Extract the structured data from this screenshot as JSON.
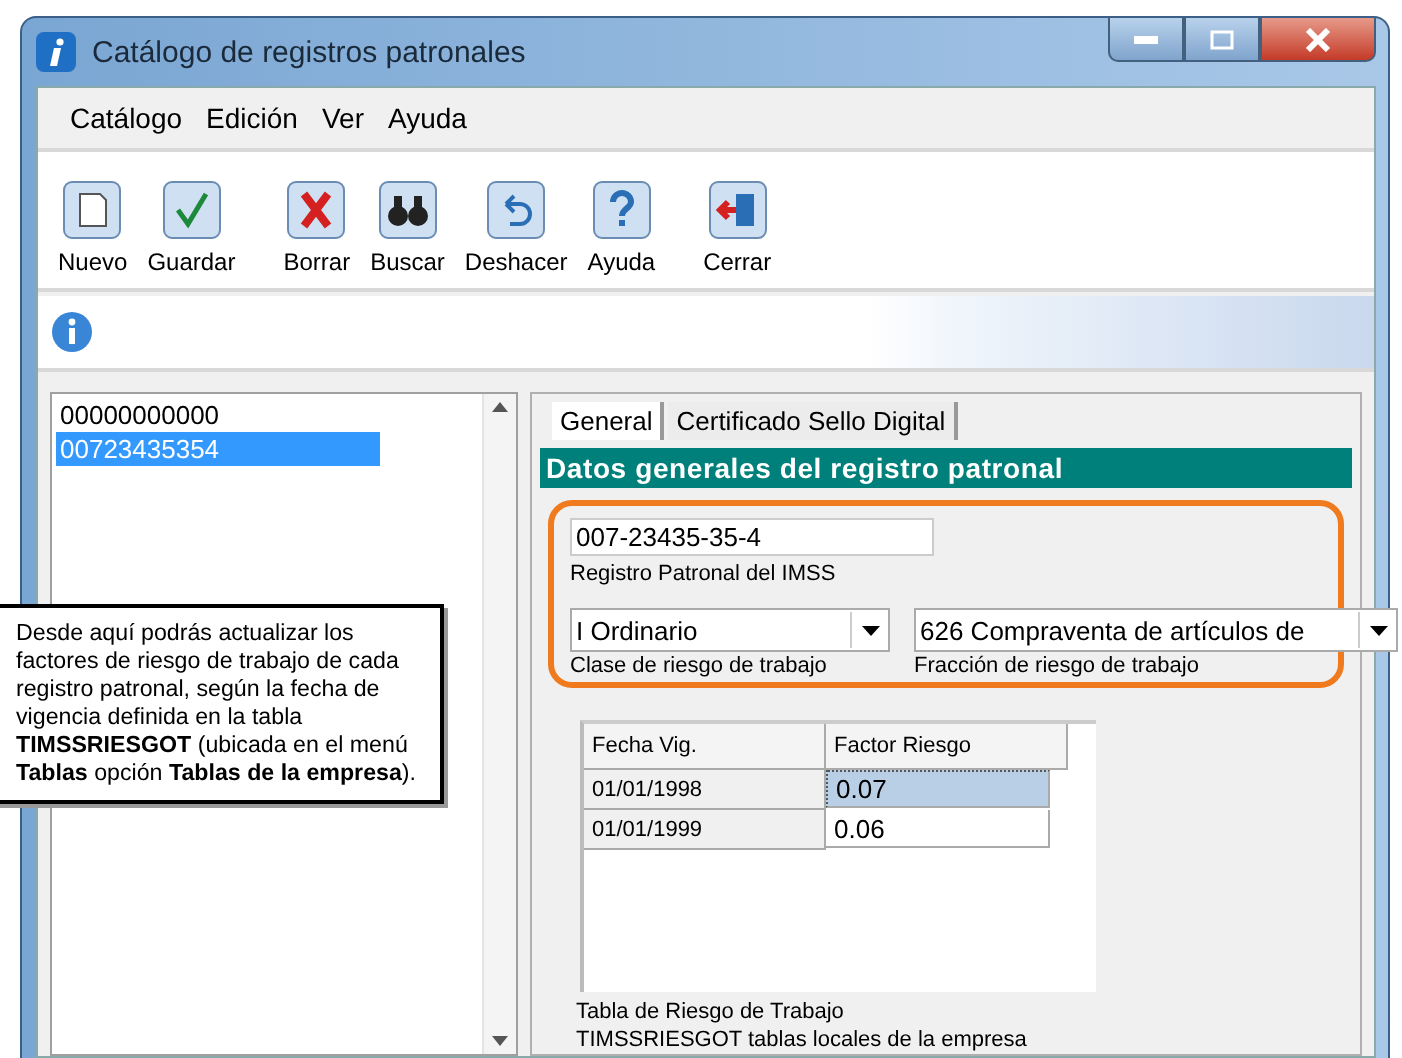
{
  "window": {
    "title": "Catálogo de registros patronales"
  },
  "menu": [
    "Catálogo",
    "Edición",
    "Ver",
    "Ayuda"
  ],
  "toolbar": [
    {
      "label": "Nuevo",
      "kind": "new"
    },
    {
      "label": "Guardar",
      "kind": "save"
    },
    {
      "label": "Borrar",
      "kind": "delete"
    },
    {
      "label": "Buscar",
      "kind": "search"
    },
    {
      "label": "Deshacer",
      "kind": "undo"
    },
    {
      "label": "Ayuda",
      "kind": "help"
    },
    {
      "label": "Cerrar",
      "kind": "close"
    }
  ],
  "list": [
    {
      "label": "00000000000",
      "selected": false
    },
    {
      "label": "00723435354",
      "selected": true
    }
  ],
  "tabs": [
    {
      "label": "General",
      "selected": true
    },
    {
      "label": "Certificado Sello Digital",
      "selected": false
    }
  ],
  "section_title": "Datos generales del registro patronal",
  "registro": {
    "value": "007-23435-35-4",
    "label": "Registro Patronal del IMSS"
  },
  "clase": {
    "value": "I Ordinario",
    "label": "Clase de riesgo de trabajo"
  },
  "fraccion": {
    "value": "626 Compraventa de artículos de",
    "label": "Fracción de riesgo de trabajo"
  },
  "grid": {
    "columns": [
      "Fecha Vig.",
      "Factor Riesgo"
    ],
    "rows": [
      {
        "date": "01/01/1998",
        "factor": "0.07",
        "selected": true
      },
      {
        "date": "01/01/1999",
        "factor": "0.06",
        "selected": false
      }
    ]
  },
  "grid_caption": [
    "Tabla de Riesgo de Trabajo",
    "TIMSSRIESGOT tablas locales de la empresa"
  ],
  "callout": "Desde aquí podrás actualizar los factores de riesgo de trabajo de cada registro patronal, según la fecha de vigencia definida en la tabla **TIMSSRIESGOT** (ubicada en el menú **Tablas** opción **Tablas de la empresa**)."
}
